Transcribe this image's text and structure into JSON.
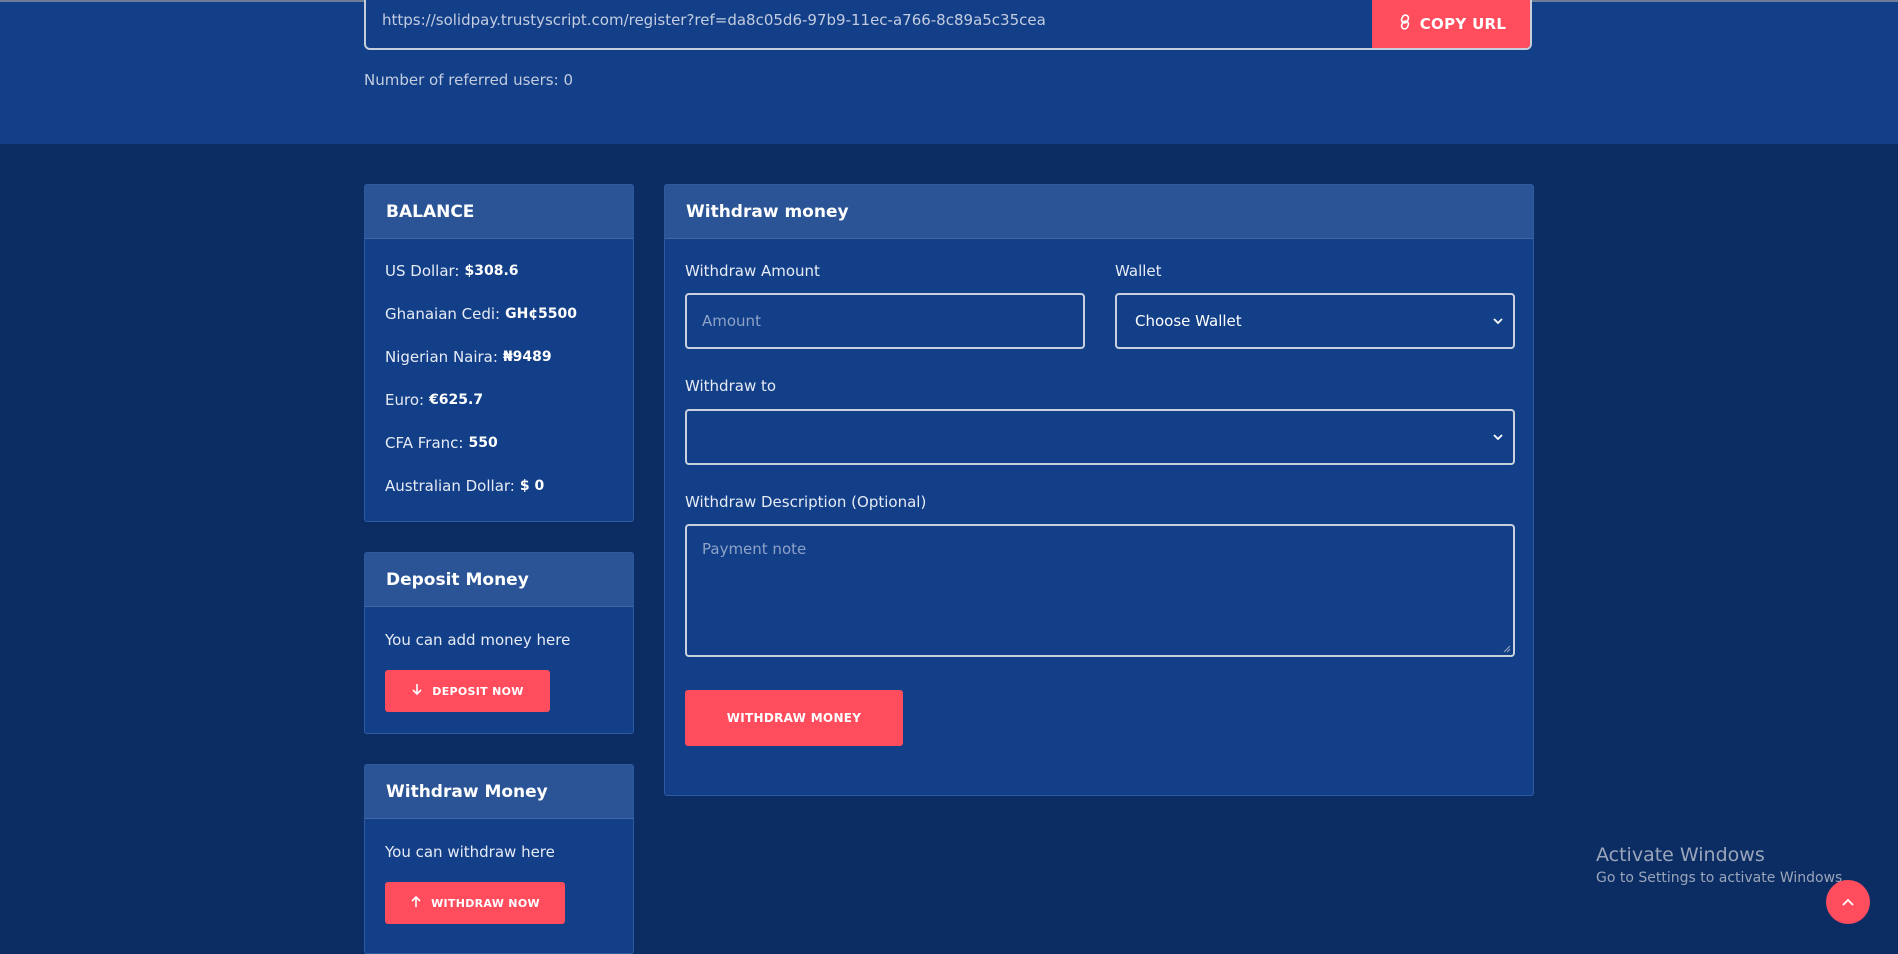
{
  "referral": {
    "url": "https://solidpay.trustyscript.com/register?ref=da8c05d6-97b9-11ec-a766-8c89a5c35cea",
    "copy_label": "COPY URL",
    "referred_text": "Number of referred users: 0"
  },
  "balance": {
    "title": "BALANCE",
    "items": [
      {
        "label": "US Dollar:",
        "value": "$308.6"
      },
      {
        "label": "Ghanaian Cedi:",
        "value": "GH¢5500"
      },
      {
        "label": "Nigerian Naira:",
        "value": "₦9489"
      },
      {
        "label": "Euro:",
        "value": "€625.7"
      },
      {
        "label": "CFA Franc:",
        "value": "550"
      },
      {
        "label": "Australian Dollar:",
        "value": "$ 0"
      }
    ]
  },
  "deposit_card": {
    "title": "Deposit Money",
    "text": "You can add money here",
    "button": "DEPOSIT NOW"
  },
  "withdraw_card": {
    "title": "Withdraw Money",
    "text": "You can withdraw here",
    "button": "WITHDRAW NOW"
  },
  "withdraw_form": {
    "title": "Withdraw money",
    "amount_label": "Withdraw Amount",
    "amount_placeholder": "Amount",
    "wallet_label": "Wallet",
    "wallet_value": "Choose Wallet",
    "withdraw_to_label": "Withdraw to",
    "withdraw_to_value": "",
    "description_label": "Withdraw Description (Optional)",
    "description_placeholder": "Payment note",
    "submit": "WITHDRAW MONEY"
  },
  "os_watermark": {
    "title": "Activate Windows",
    "subtitle": "Go to Settings to activate Windows."
  },
  "colors": {
    "accent": "#ff4d5e",
    "top_band": "#123f88",
    "page_bg": "#0c2d63",
    "card_bg": "#123f88",
    "card_header": "#2a5496"
  }
}
